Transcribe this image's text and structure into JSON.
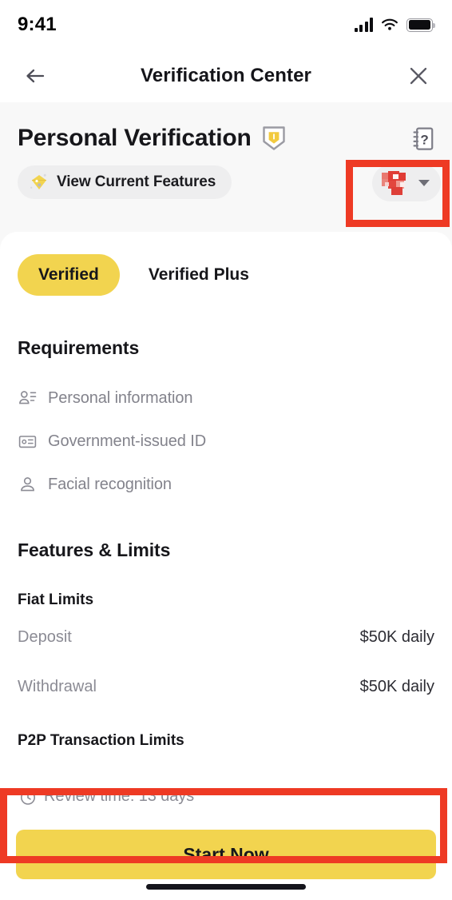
{
  "status_bar": {
    "time": "9:41",
    "signal_icon": "signal-bars-icon",
    "wifi_icon": "wifi-icon",
    "battery_icon": "battery-full-icon"
  },
  "nav": {
    "back_icon": "back-arrow-icon",
    "title": "Verification Center",
    "close_icon": "close-icon"
  },
  "header": {
    "title": "Personal Verification",
    "shield_icon": "verified-shield-icon",
    "help_icon": "help-question-icon",
    "features_pill": {
      "icon": "diamond-gem-icon",
      "label": "View Current Features"
    },
    "account_switcher": {
      "avatar_icon": "redacted-avatar-icon",
      "caret_icon": "chevron-down-icon"
    }
  },
  "tabs": [
    {
      "label": "Verified",
      "active": true
    },
    {
      "label": "Verified Plus",
      "active": false
    }
  ],
  "requirements": {
    "heading": "Requirements",
    "items": [
      {
        "icon": "person-details-icon",
        "label": "Personal information"
      },
      {
        "icon": "id-card-icon",
        "label": "Government-issued ID"
      },
      {
        "icon": "person-outline-icon",
        "label": "Facial recognition"
      }
    ]
  },
  "features_limits": {
    "heading": "Features & Limits",
    "groups": [
      {
        "title": "Fiat Limits",
        "rows": [
          {
            "label": "Deposit",
            "value": "$50K daily"
          },
          {
            "label": "Withdrawal",
            "value": "$50K daily"
          }
        ]
      },
      {
        "title": "P2P Transaction Limits",
        "rows": []
      }
    ]
  },
  "footer": {
    "review_icon": "stopwatch-icon",
    "review_text": "Review time: 13 days",
    "cta_label": "Start Now"
  },
  "colors": {
    "accent_yellow": "#f2d44f",
    "highlight_red": "#ee3a24",
    "page_bg": "#f8f8f8",
    "card_bg": "#ffffff",
    "muted_text": "#8b8b94",
    "primary_text": "#17171b"
  }
}
